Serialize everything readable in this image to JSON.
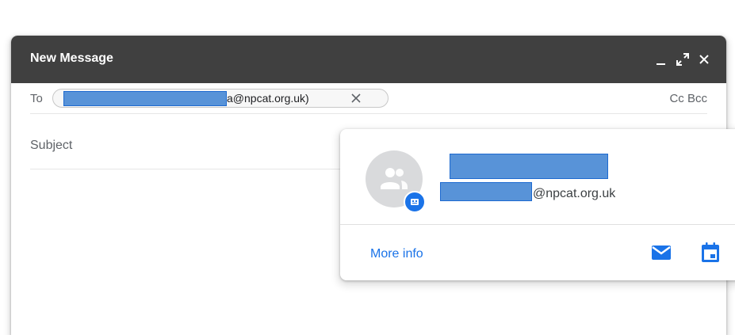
{
  "compose": {
    "title": "New Message",
    "to_label": "To",
    "recipient_suffix": "a@npcat.org.uk)",
    "cc_label": "Cc",
    "bcc_label": "Bcc",
    "subject_placeholder": "Subject"
  },
  "contact_card": {
    "email_domain": "@npcat.org.uk",
    "more_info_label": "More info"
  },
  "icons": {
    "header": [
      "minimize-icon",
      "expand-icon",
      "close-icon"
    ],
    "chip": "remove-recipient-icon",
    "card": [
      "people-icon",
      "group-badge-icon",
      "mail-icon",
      "calendar-icon"
    ]
  },
  "colors": {
    "header_bg": "#404040",
    "accent": "#1a73e8",
    "redaction": "#5893d8"
  }
}
